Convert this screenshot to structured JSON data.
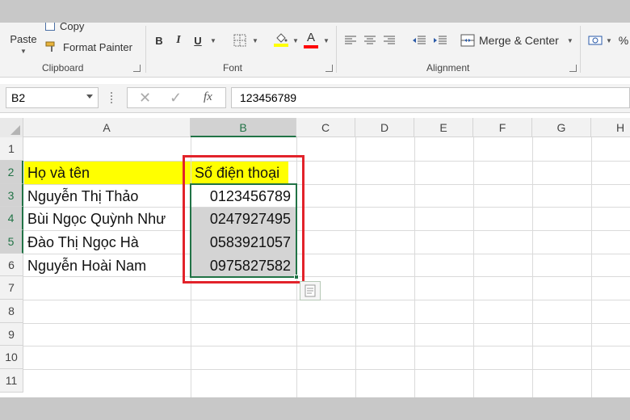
{
  "ribbon": {
    "clipboard": {
      "paste_label": "Paste",
      "copy_label": "Copy",
      "format_painter_label": "Format Painter",
      "group_label": "Clipboard"
    },
    "font": {
      "bold": "B",
      "italic": "I",
      "underline": "U",
      "group_label": "Font",
      "highlight_color": "#ffff00",
      "font_color": "#ff0000"
    },
    "alignment": {
      "merge_center_label": "Merge & Center",
      "group_label": "Alignment"
    },
    "number": {
      "percent_label": "%"
    }
  },
  "formula_bar": {
    "name_box": "B2",
    "fx_label": "fx",
    "formula_value": "123456789"
  },
  "sheet": {
    "columns": [
      "A",
      "B",
      "C",
      "D",
      "E",
      "F",
      "G",
      "H"
    ],
    "rows": [
      "1",
      "2",
      "3",
      "4",
      "5",
      "6",
      "7",
      "8",
      "9",
      "10",
      "11"
    ],
    "header": {
      "name": "Họ và tên",
      "phone": "Số điện thoại"
    },
    "data": [
      {
        "name": "Nguyễn Thị Thảo",
        "phone": "0123456789"
      },
      {
        "name": "Bùi Ngọc Quỳnh Như",
        "phone": "0247927495"
      },
      {
        "name": "Đào Thị Ngọc Hà",
        "phone": "0583921057"
      },
      {
        "name": "Nguyễn Hoài Nam",
        "phone": "0975827582"
      }
    ]
  },
  "colors": {
    "accent": "#217346",
    "highlight_box": "#e2232a",
    "header_fill": "#ffff00"
  }
}
